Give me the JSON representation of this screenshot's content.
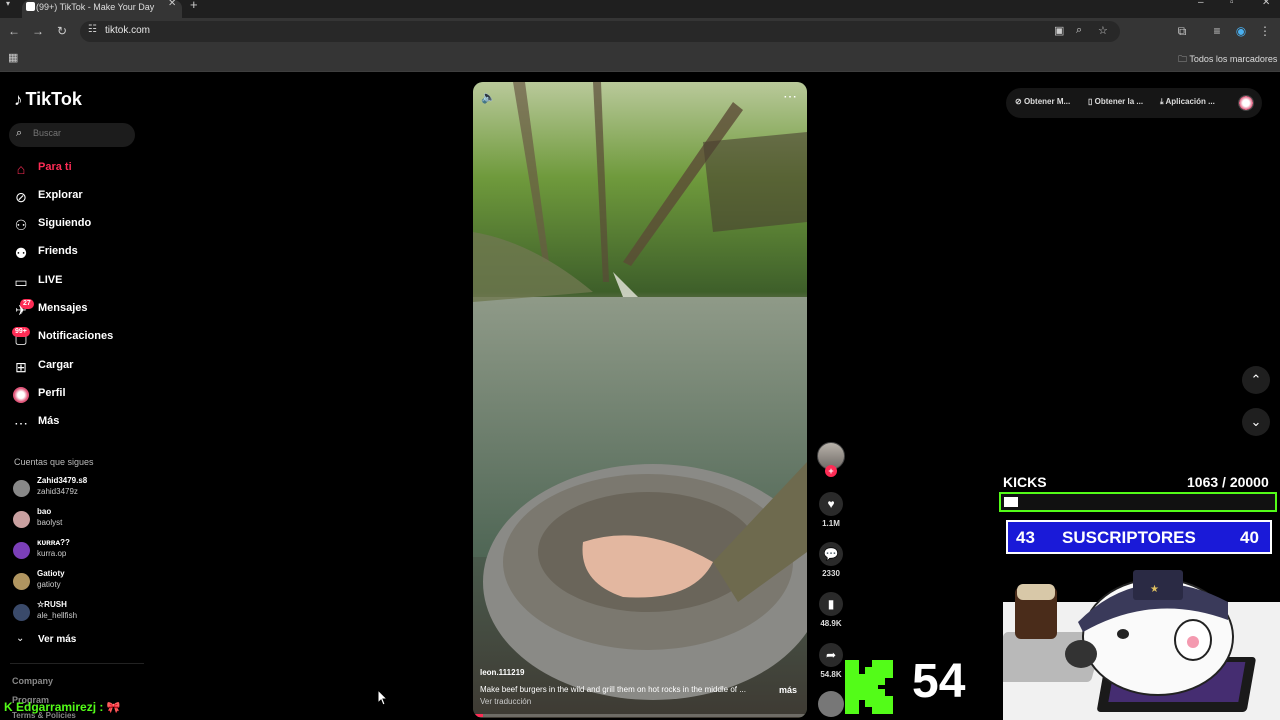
{
  "browser": {
    "tab_title": "(99+) TikTok - Make Your Day",
    "url": "tiktok.com",
    "bookmarks_all": "Todos los marcadores"
  },
  "tiktok": {
    "logo": "TikTok",
    "search_placeholder": "Buscar",
    "nav": [
      {
        "label": "Para ti",
        "icon": "home-icon",
        "active": true
      },
      {
        "label": "Explorar",
        "icon": "compass-icon"
      },
      {
        "label": "Siguiendo",
        "icon": "following-icon"
      },
      {
        "label": "Friends",
        "icon": "friends-icon"
      },
      {
        "label": "LIVE",
        "icon": "live-icon"
      },
      {
        "label": "Mensajes",
        "icon": "messages-icon",
        "badge": "27"
      },
      {
        "label": "Notificaciones",
        "icon": "notifications-icon",
        "badge": "99+"
      },
      {
        "label": "Cargar",
        "icon": "upload-icon"
      },
      {
        "label": "Perfil",
        "icon": "profile-icon"
      },
      {
        "label": "Más",
        "icon": "more-icon"
      }
    ],
    "following_title": "Cuentas que sigues",
    "following": [
      {
        "name": "Zahid3479.s8",
        "user": "zahid3479z"
      },
      {
        "name": "bao",
        "user": "baolyst"
      },
      {
        "name": "ĸᴜʀʀᴀ??",
        "user": "kurra.op"
      },
      {
        "name": "Gatioty",
        "user": "gatioty"
      },
      {
        "name": "☆RUSH",
        "user": "ale_hellfish"
      }
    ],
    "see_more": "Ver más",
    "footer": [
      "Company",
      "Program",
      "Terms & Policies"
    ],
    "top_actions": [
      "Obtener M...",
      "Obtener la ...",
      "Aplicación ..."
    ],
    "video": {
      "author": "leon.111219",
      "description": "Make beef burgers in the wild and grill them on hot rocks in the middle of ...",
      "more": "más",
      "translate": "Ver traducción",
      "progress": 0.03
    },
    "actions": {
      "likes": "1.1M",
      "comments": "2330",
      "saves": "48.9K",
      "shares": "54.8K"
    }
  },
  "overlay": {
    "kicks_label": "KICKS",
    "kicks_count": "1063   / 20000",
    "kicks_current": 1063,
    "kicks_goal": 20000,
    "subs_left": "43",
    "subs_label": "SUSCRIPTORES",
    "subs_right": "40",
    "kick_number": "54",
    "chat_user": "Edgarramirezj :",
    "accent": "#53fc18"
  }
}
